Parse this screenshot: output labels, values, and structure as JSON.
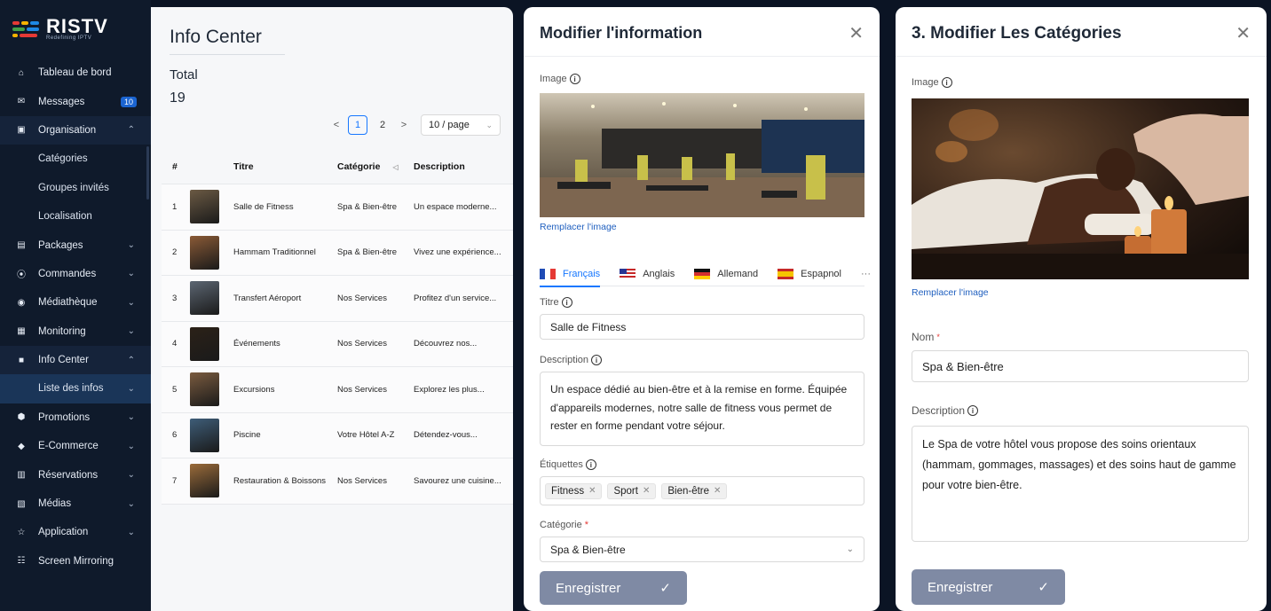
{
  "brand": {
    "name": "RISTV",
    "tagline": "Redefining IPTV",
    "colors": [
      "#e53935",
      "#f6b300",
      "#1e88e5",
      "#43a047"
    ]
  },
  "sidebar": {
    "items": [
      {
        "label": "Tableau de bord",
        "icon": "dashboard-icon"
      },
      {
        "label": "Messages",
        "icon": "message-icon",
        "badge": "10"
      },
      {
        "label": "Organisation",
        "icon": "organisation-icon",
        "chevron": "up"
      },
      {
        "label": "Catégories",
        "sub": true
      },
      {
        "label": "Groupes invités",
        "sub": true
      },
      {
        "label": "Localisation",
        "sub": true
      },
      {
        "label": "Packages",
        "icon": "package-icon",
        "chevron": "down"
      },
      {
        "label": "Commandes",
        "icon": "orders-icon",
        "chevron": "down"
      },
      {
        "label": "Médiathèque",
        "icon": "media-library-icon",
        "chevron": "down"
      },
      {
        "label": "Monitoring",
        "icon": "monitoring-icon",
        "chevron": "down"
      },
      {
        "label": "Info Center",
        "icon": "info-center-icon",
        "chevron": "up"
      },
      {
        "label": "Liste des infos",
        "sub": true,
        "active": true,
        "chevron": "down"
      },
      {
        "label": "Promotions",
        "icon": "promotions-icon",
        "chevron": "down"
      },
      {
        "label": "E-Commerce",
        "icon": "ecommerce-icon",
        "chevron": "down"
      },
      {
        "label": "Réservations",
        "icon": "reservations-icon",
        "chevron": "down"
      },
      {
        "label": "Médias",
        "icon": "medias-icon",
        "chevron": "down"
      },
      {
        "label": "Application",
        "icon": "application-icon",
        "chevron": "down"
      },
      {
        "label": "Screen Mirroring",
        "icon": "screen-mirroring-icon"
      }
    ]
  },
  "info_center": {
    "title": "Info Center",
    "total_label": "Total",
    "total_value": "19",
    "pagination": {
      "prev": "<",
      "pages": [
        "1",
        "2"
      ],
      "current": "1",
      "next": ">",
      "page_size": "10 / page"
    },
    "columns": [
      "#",
      "Titre",
      "Catégorie",
      "Description"
    ],
    "rows": [
      {
        "n": "1",
        "title": "Salle de Fitness",
        "category": "Spa & Bien-être",
        "description": "Un espace moderne...",
        "thumb": "#6b5a44"
      },
      {
        "n": "2",
        "title": "Hammam Traditionnel",
        "category": "Spa & Bien-être",
        "description": "Vivez une expérience...",
        "thumb": "#8a5a36"
      },
      {
        "n": "3",
        "title": "Transfert Aéroport",
        "category": "Nos Services",
        "description": "Profitez d'un service...",
        "thumb": "#5c6672"
      },
      {
        "n": "4",
        "title": "Événements",
        "category": "Nos Services",
        "description": "Découvrez nos...",
        "thumb": "#2b2118"
      },
      {
        "n": "5",
        "title": "Excursions",
        "category": "Nos Services",
        "description": "Explorez les plus...",
        "thumb": "#7a5b3f"
      },
      {
        "n": "6",
        "title": "Piscine",
        "category": "Votre Hôtel A-Z",
        "description": "Détendez-vous...",
        "thumb": "#3e5d78"
      },
      {
        "n": "7",
        "title": "Restauration & Boissons",
        "category": "Nos Services",
        "description": "Savourez une cuisine...",
        "thumb": "#9a6b3a"
      }
    ]
  },
  "edit_info": {
    "title": "Modifier l'information",
    "image_label": "Image",
    "replace_image": "Remplacer l'image",
    "tabs": [
      {
        "label": "Français",
        "flag": "fr"
      },
      {
        "label": "Anglais",
        "flag": "us"
      },
      {
        "label": "Allemand",
        "flag": "de"
      },
      {
        "label": "Espapnol",
        "flag": "es"
      }
    ],
    "tabs_more": "···",
    "title_label": "Titre",
    "title_value": "Salle de Fitness",
    "description_label": "Description",
    "description_value": "Un espace dédié au bien-être et à la remise en forme. Équipée d'appareils modernes, notre salle de fitness vous permet de rester en forme pendant votre séjour.",
    "tags_label": "Étiquettes",
    "tags": [
      "Fitness",
      "Sport",
      "Bien-être"
    ],
    "category_label": "Catégorie",
    "category_value": "Spa & Bien-être",
    "save": "Enregistrer"
  },
  "edit_category": {
    "title": "3. Modifier Les Catégories",
    "image_label": "Image",
    "replace_image": "Remplacer l'image",
    "name_label": "Nom",
    "name_value": "Spa & Bien-être",
    "description_label": "Description",
    "description_value": "Le Spa de votre hôtel vous propose des soins orientaux (hammam, gommages, massages) et des soins haut de gamme pour votre bien-être.",
    "save": "Enregistrer"
  }
}
